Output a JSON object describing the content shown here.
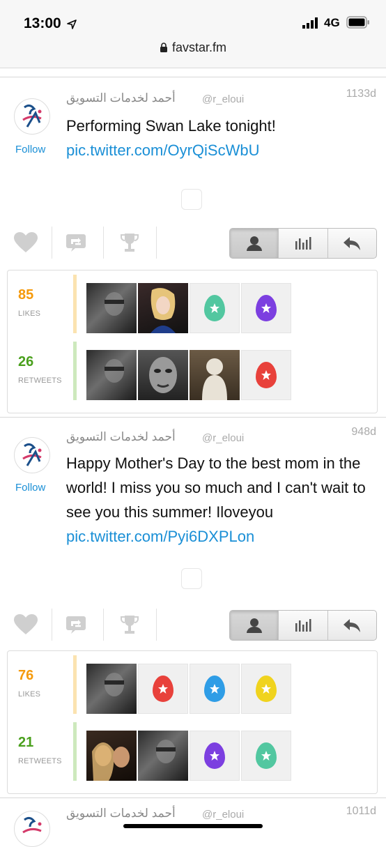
{
  "status_bar": {
    "time": "13:00",
    "network": "4G"
  },
  "browser": {
    "url": "favstar.fm"
  },
  "colors": {
    "link": "#1a8fd6",
    "likes": "#f59a0c",
    "retweets": "#4aa01d",
    "egg_teal": "#52c7a0",
    "egg_purple": "#7c3fe0",
    "egg_red": "#e8413b",
    "egg_blue": "#2f9de6",
    "egg_yellow": "#f0d31e"
  },
  "tweets": [
    {
      "author": "أحمد لخدمات التسويق",
      "handle": "@r_eloui",
      "age": "1133d",
      "follow_label": "Follow",
      "text": "Performing Swan Lake tonight!",
      "link": "pic.twitter.com/OyrQiScWbU",
      "likes": {
        "count": "85",
        "label": "LIKES",
        "avatars": [
          "photo-dark",
          "photo-blonde",
          "egg-teal",
          "egg-purple"
        ]
      },
      "retweets": {
        "count": "26",
        "label": "RETWEETS",
        "avatars": [
          "photo-dark",
          "photo-face",
          "photo-costume",
          "egg-red"
        ]
      }
    },
    {
      "author": "أحمد لخدمات التسويق",
      "handle": "@r_eloui",
      "age": "948d",
      "follow_label": "Follow",
      "text": "Happy Mother's Day to the best mom in the world! I miss you so much and I can't wait to see you this summer! Iloveyou",
      "link": "pic.twitter.com/Pyi6DXPLon",
      "likes": {
        "count": "76",
        "label": "LIKES",
        "avatars": [
          "photo-dark",
          "egg-red",
          "egg-blue",
          "egg-yellow"
        ]
      },
      "retweets": {
        "count": "21",
        "label": "RETWEETS",
        "avatars": [
          "photo-couple",
          "photo-dark",
          "egg-purple",
          "egg-teal"
        ]
      }
    },
    {
      "author": "أحمد لخدمات التسويق",
      "handle": "@r_eloui",
      "age": "1011d"
    }
  ]
}
